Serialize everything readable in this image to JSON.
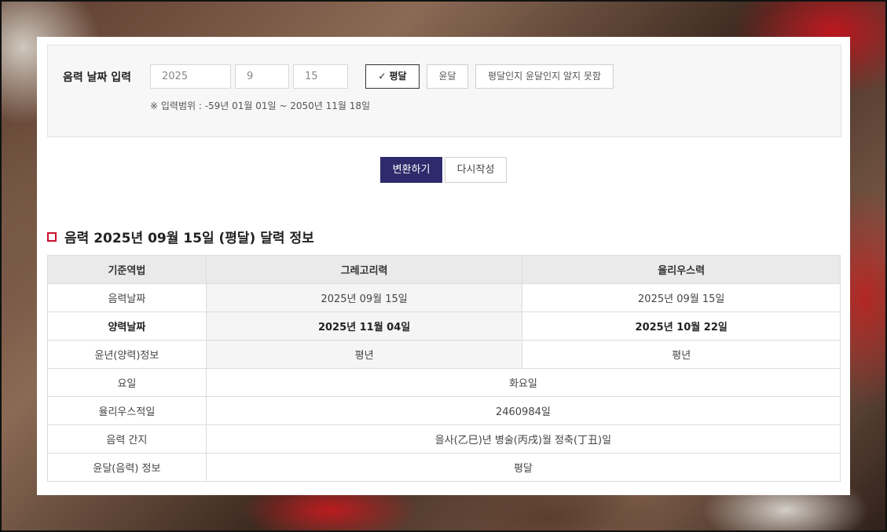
{
  "input": {
    "title": "음력 날짜 입력",
    "year": "2025",
    "month": "9",
    "day": "15",
    "options": [
      "평달",
      "윤달",
      "평달인지 윤달인지 알지 못함"
    ],
    "range_note": "※ 입력범위 : -59년 01월 01일 ~ 2050년 11월 18일"
  },
  "buttons": {
    "convert": "변환하기",
    "reset": "다시작성"
  },
  "result": {
    "title": "음력 2025년 09월 15일 (평달) 달력 정보",
    "headers": [
      "기준역법",
      "그레고리력",
      "율리우스력"
    ],
    "rows": [
      {
        "label": "음력날짜",
        "gregorian": "2025년 09월 15일",
        "julian": "2025년 09월 15일"
      },
      {
        "label": "양력날짜",
        "gregorian": "2025년 11월 04일",
        "julian": "2025년 10월 22일"
      },
      {
        "label": "윤년(양력)정보",
        "gregorian": "평년",
        "julian": "평년"
      }
    ],
    "merged_rows": [
      {
        "label": "요일",
        "value": "화요일"
      },
      {
        "label": "율리우스적일",
        "value": "2460984일"
      },
      {
        "label": "음력 간지",
        "value": "을사(乙巳)년 병술(丙戌)월 정축(丁丑)일"
      },
      {
        "label": "윤달(음력) 정보",
        "value": "평달"
      }
    ]
  },
  "colors": {
    "primary_button": "#2f2a6b",
    "accent": "#c8102e"
  }
}
